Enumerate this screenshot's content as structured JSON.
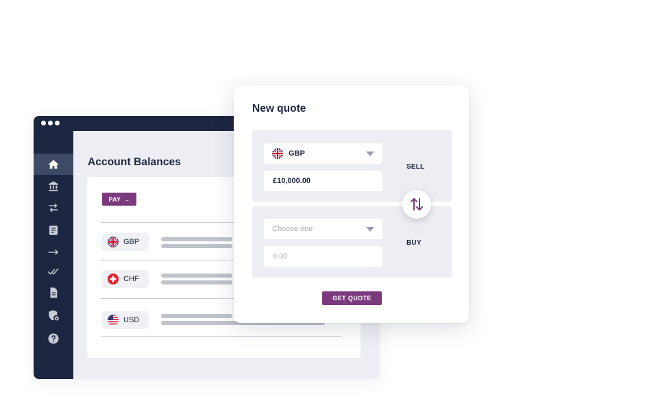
{
  "window": {
    "sidebar": {
      "items": [
        {
          "icon": "home-icon",
          "active": true
        },
        {
          "icon": "bank-icon",
          "active": false
        },
        {
          "icon": "transfer-arrows-icon",
          "active": false
        },
        {
          "icon": "document-list-icon",
          "active": false
        },
        {
          "icon": "arrow-right-icon",
          "active": false
        },
        {
          "icon": "double-check-icon",
          "active": false
        },
        {
          "icon": "file-icon",
          "active": false
        },
        {
          "icon": "shield-lock-icon",
          "active": false
        },
        {
          "icon": "help-icon",
          "active": false
        }
      ]
    },
    "page_title": "Account Balances",
    "pay_button": {
      "label": "PAY",
      "arrow": "→"
    },
    "balances": [
      {
        "code": "GBP",
        "flag": "uk-flag-icon"
      },
      {
        "code": "CHF",
        "flag": "swiss-flag-icon"
      },
      {
        "code": "USD",
        "flag": "us-flag-icon"
      }
    ]
  },
  "quote": {
    "title": "New quote",
    "sell": {
      "label": "SELL",
      "currency": "GBP",
      "amount": "£10,000.00"
    },
    "buy": {
      "label": "BUY",
      "currency_placeholder": "Choose one",
      "amount_placeholder": "0.00"
    },
    "get_quote_label": "GET QUOTE"
  },
  "colors": {
    "navy": "#1d2640",
    "accent_purple": "#7b3a7e",
    "panel_gray": "#eceef3",
    "skeleton_gray": "#bfc3cc"
  }
}
